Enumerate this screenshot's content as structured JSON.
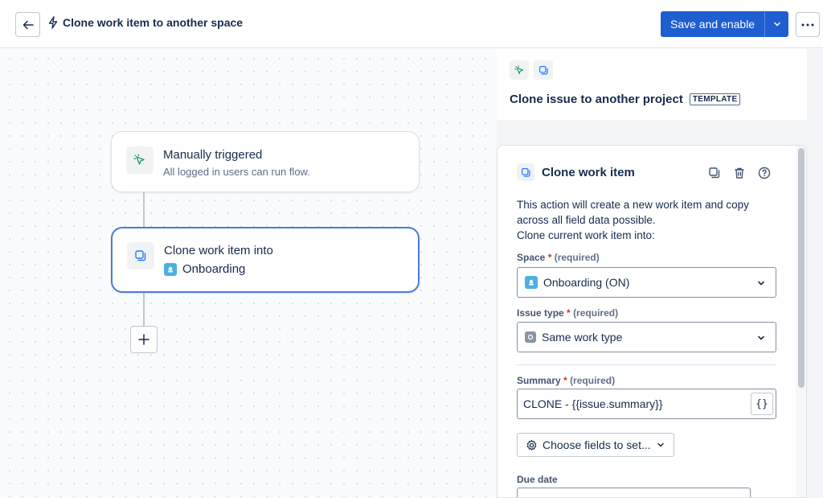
{
  "header": {
    "title": "Clone work item to another space",
    "save_label": "Save and enable"
  },
  "canvas": {
    "trigger_node": {
      "title": "Manually triggered",
      "subtitle": "All logged in users can run flow."
    },
    "action_node": {
      "title": "Clone work item into",
      "target": "Onboarding"
    }
  },
  "template": {
    "title": "Clone issue to another project",
    "badge": "TEMPLATE"
  },
  "config": {
    "title": "Clone work item",
    "description_line1": "This action will create a new work item and copy",
    "description_line2": "across all field data possible.",
    "description_line3": "Clone current work item into:",
    "space": {
      "label": "Space",
      "required_mark": "*",
      "required_text": "(required)",
      "value": "Onboarding (ON)"
    },
    "issue_type": {
      "label": "Issue type",
      "required_mark": "*",
      "required_text": "(required)",
      "value": "Same work type"
    },
    "summary": {
      "label": "Summary",
      "required_mark": "*",
      "required_text": "(required)",
      "value": "CLONE - {{issue.summary}}",
      "var_button": "{}"
    },
    "choose_fields_label": "Choose fields to set...",
    "due_date_label": "Due date"
  },
  "colors": {
    "primary": "#1f5ed1",
    "selected_border": "#4c7bd9",
    "trigger_icon": "#22a06b",
    "clone_icon": "#1d7afc",
    "required": "#c9372c"
  }
}
